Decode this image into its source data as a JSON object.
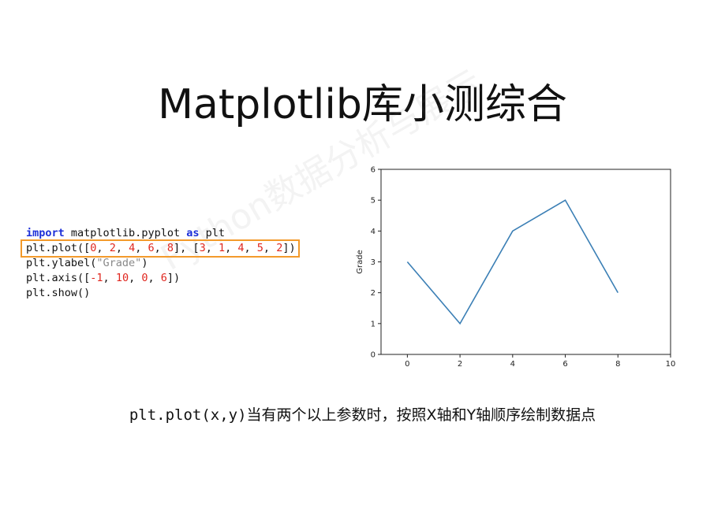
{
  "slide": {
    "title": "Matplotlib库小测综合",
    "watermark": "Python数据分析与展示",
    "caption_code": "plt.plot(x,y)",
    "caption_text": "当有两个以上参数时，按照X轴和Y轴顺序绘制数据点"
  },
  "code": {
    "line1_kw": "import",
    "line1_rest": " matplotlib.pyplot ",
    "line1_kw2": "as",
    "line1_end": " plt",
    "line2": [
      {
        "t": "plt.plot([",
        "c": ""
      },
      {
        "t": "0",
        "c": "num"
      },
      {
        "t": ", ",
        "c": ""
      },
      {
        "t": "2",
        "c": "num"
      },
      {
        "t": ", ",
        "c": ""
      },
      {
        "t": "4",
        "c": "num"
      },
      {
        "t": ", ",
        "c": ""
      },
      {
        "t": "6",
        "c": "num"
      },
      {
        "t": ", ",
        "c": ""
      },
      {
        "t": "8",
        "c": "num"
      },
      {
        "t": "], [",
        "c": ""
      },
      {
        "t": "3",
        "c": "num"
      },
      {
        "t": ", ",
        "c": ""
      },
      {
        "t": "1",
        "c": "num"
      },
      {
        "t": ", ",
        "c": ""
      },
      {
        "t": "4",
        "c": "num"
      },
      {
        "t": ", ",
        "c": ""
      },
      {
        "t": "5",
        "c": "num"
      },
      {
        "t": ", ",
        "c": ""
      },
      {
        "t": "2",
        "c": "num"
      },
      {
        "t": "])",
        "c": ""
      }
    ],
    "line3_a": "plt.ylabel(",
    "line3_str": "\"Grade\"",
    "line3_b": ")",
    "line4": [
      {
        "t": "plt.axis([",
        "c": ""
      },
      {
        "t": "-1",
        "c": "num"
      },
      {
        "t": ", ",
        "c": ""
      },
      {
        "t": "10",
        "c": "num"
      },
      {
        "t": ", ",
        "c": ""
      },
      {
        "t": "0",
        "c": "num"
      },
      {
        "t": ", ",
        "c": ""
      },
      {
        "t": "6",
        "c": "num"
      },
      {
        "t": "])",
        "c": ""
      }
    ],
    "line5": "plt.show()"
  },
  "colors": {
    "highlight_border": "#f39a2b",
    "line_color": "#3b7fb5",
    "keyword": "#1c2fd8",
    "number": "#e0271f",
    "string": "#8a8a8a"
  },
  "chart_data": {
    "type": "line",
    "x": [
      0,
      2,
      4,
      6,
      8
    ],
    "y": [
      3,
      1,
      4,
      5,
      2
    ],
    "xlim": [
      -1,
      10
    ],
    "ylim": [
      0,
      6
    ],
    "xticks": [
      0,
      2,
      4,
      6,
      8,
      10
    ],
    "yticks": [
      0,
      1,
      2,
      3,
      4,
      5,
      6
    ],
    "xlabel": "",
    "ylabel": "Grade",
    "title": "",
    "grid": false
  }
}
